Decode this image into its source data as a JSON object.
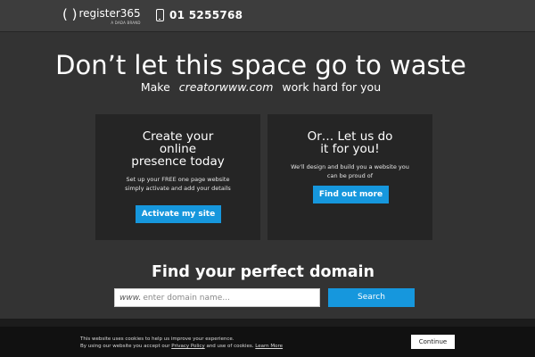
{
  "header": {
    "logo_mark": "( )",
    "logo_name": "register365",
    "logo_tagline": "A DADA BRAND",
    "phone_number": "01 5255768"
  },
  "hero": {
    "headline": "Don’t let this space go to waste",
    "sub_before": "Make",
    "sub_domain": "creatorwww.com",
    "sub_after": "work hard for you"
  },
  "panels": {
    "left": {
      "title_line1": "Create your",
      "title_line2": "online",
      "title_line3": "presence today",
      "text": "Set up your FREE one page website simply activate and add your details",
      "button_label": "Activate my site"
    },
    "right": {
      "title_line1": "Or… Let us do",
      "title_line2": "it for you!",
      "text": "We'll design and build you a website you can be proud of",
      "button_label": "Find out more"
    }
  },
  "domain_search": {
    "title": "Find your perfect domain",
    "prefix": "www.",
    "placeholder": "enter domain name...",
    "button_label": "Search"
  },
  "cookie_banner": {
    "line1": "This website uses cookies to help us improve your experience.",
    "line2_before": "By using our website you accept our",
    "privacy_link": "Privacy Policy",
    "line2_middle": "and use of cookies.",
    "learn_more_link": "Learn More",
    "button_label": "Continue"
  },
  "colors": {
    "page_background": "#333333",
    "top_bar": "#3d3d3d",
    "panel_background": "#252525",
    "accent_blue": "#1697dd",
    "cookie_bar": "#111111"
  },
  "icons": {
    "phone": "phone-icon"
  }
}
